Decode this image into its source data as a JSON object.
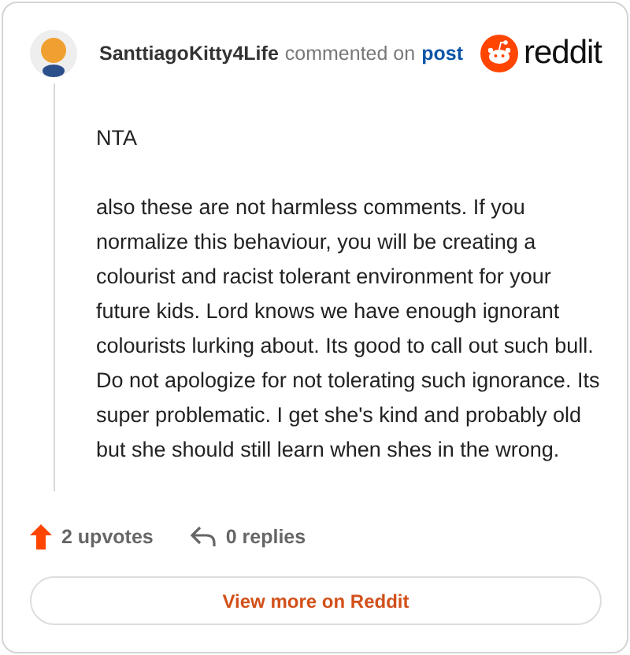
{
  "comment": {
    "author": "SanttiagoKitty4Life",
    "action": "commented on",
    "link": "post",
    "brand": "reddit",
    "paragraphs": [
      "NTA",
      "also these are not harmless comments. If you normalize this behaviour, you will be creating a colourist and racist tolerant environment for your future kids. Lord knows we have enough ignorant colourists lurking about. Its good to call out such bull. Do not apologize for not tolerating such ignorance. Its super problematic. I get she's kind and probably old but she should still learn when shes in the wrong."
    ]
  },
  "stats": {
    "upvotes": "2 upvotes",
    "replies": "0 replies"
  },
  "button": "View more on Reddit"
}
